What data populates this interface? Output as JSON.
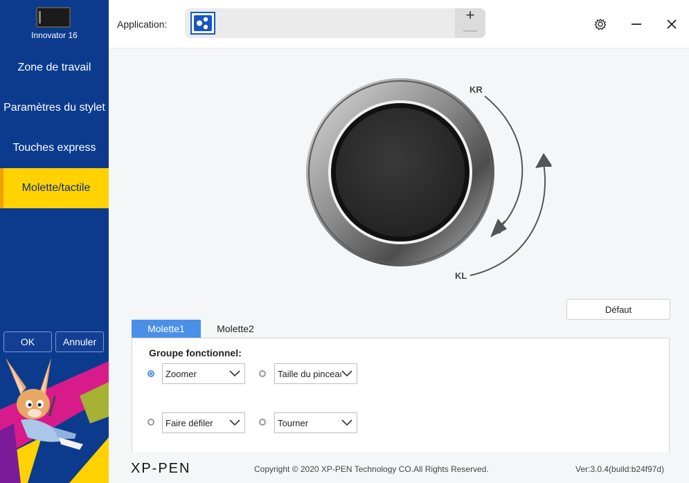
{
  "sidebar": {
    "device_name": "Innovator 16",
    "nav": [
      {
        "label": "Zone de travail",
        "active": false
      },
      {
        "label": "Paramètres du stylet",
        "active": false
      },
      {
        "label": "Touches express",
        "active": false
      },
      {
        "label": "Molette/tactile",
        "active": true
      }
    ],
    "ok_label": "OK",
    "cancel_label": "Annuler"
  },
  "topbar": {
    "application_label": "Application:",
    "add_symbol": "+",
    "remove_symbol": "—"
  },
  "dial": {
    "kr_label": "KR",
    "kl_label": "KL"
  },
  "main": {
    "default_button": "Défaut",
    "tabs": [
      "Molette1",
      "Molette2"
    ],
    "group_title": "Groupe fonctionnel:",
    "functions": [
      {
        "value": "Zoomer",
        "selected": true
      },
      {
        "value": "Taille du pinceau",
        "selected": false
      },
      {
        "value": "Faire défiler",
        "selected": false
      },
      {
        "value": "Tourner",
        "selected": false
      }
    ]
  },
  "footer": {
    "logo": "XP-PEN",
    "copyright": "Copyright © 2020 XP-PEN Technology CO.All Rights Reserved.",
    "version": "Ver:3.0.4(build:b24f97d)"
  },
  "colors": {
    "sidebar": "#0c3b8e",
    "active_nav": "#ffd200",
    "accent": "#4a90e8"
  }
}
